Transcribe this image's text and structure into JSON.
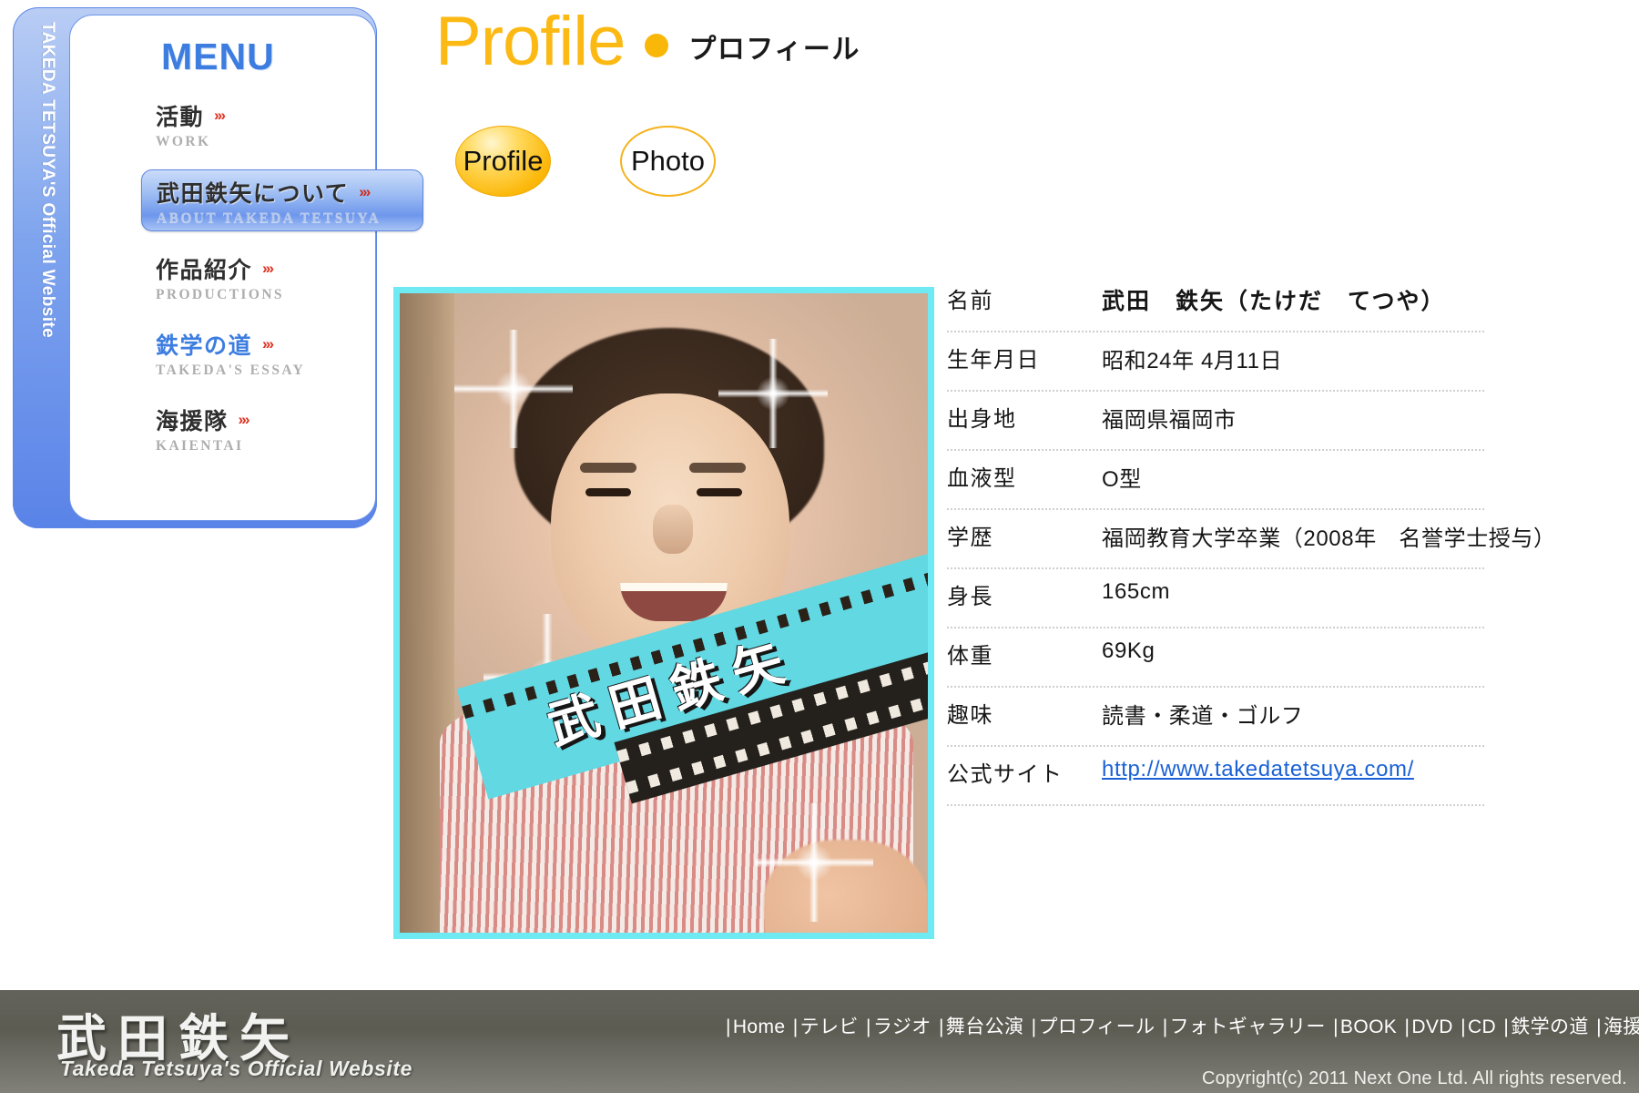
{
  "sidebar": {
    "vertical_label": "TAKEDA TETSUYA'S Official Website",
    "menu_title": "MENU",
    "items": [
      {
        "jp": "活動",
        "en": "WORK",
        "arrow": "›››",
        "active": false,
        "blue": false
      },
      {
        "jp": "武田鉄矢について",
        "en": "ABOUT TAKEDA TETSUYA",
        "arrow": "›››",
        "active": true,
        "blue": false
      },
      {
        "jp": "作品紹介",
        "en": "PRODUCTIONS",
        "arrow": "›››",
        "active": false,
        "blue": false
      },
      {
        "jp": "鉄学の道",
        "en": "TAKEDA'S ESSAY",
        "arrow": "›››",
        "active": false,
        "blue": true
      },
      {
        "jp": "海援隊",
        "en": "KAIENTAI",
        "arrow": "›››",
        "active": false,
        "blue": false
      }
    ]
  },
  "header": {
    "title_en": "Profile",
    "title_jp": "プロフィール",
    "accent_color": "#fcb913"
  },
  "tabs": [
    {
      "label": "Profile",
      "selected": true
    },
    {
      "label": "Photo",
      "selected": false
    }
  ],
  "photo": {
    "caption": "武田鉄矢",
    "border_color": "#6feaf2",
    "film_color": "#62d8e2"
  },
  "profile": {
    "rows": [
      {
        "label": "名前",
        "value": "武田　鉄矢（たけだ　てつや）",
        "link": false
      },
      {
        "label": "生年月日",
        "value": "昭和24年 4月11日",
        "link": false
      },
      {
        "label": "出身地",
        "value": "福岡県福岡市",
        "link": false
      },
      {
        "label": "血液型",
        "value": "O型",
        "link": false
      },
      {
        "label": "学歴",
        "value": "福岡教育大学卒業（2008年　名誉学士授与）",
        "link": false
      },
      {
        "label": "身長",
        "value": "165cm",
        "link": false
      },
      {
        "label": "体重",
        "value": "69Kg",
        "link": false
      },
      {
        "label": "趣味",
        "value": "読書・柔道・ゴルフ",
        "link": false
      },
      {
        "label": "公式サイト",
        "value": "http://www.takedatetsuya.com/",
        "link": true
      }
    ]
  },
  "footer": {
    "logo_jp": "武田鉄矢",
    "logo_en": "Takeda Tetsuya's Official Website",
    "nav": [
      "Home",
      "テレビ",
      "ラジオ",
      "舞台公演",
      "プロフィール",
      "フォトギャラリー",
      "BOOK",
      "DVD",
      "CD",
      "鉄学の道",
      "海援隊"
    ],
    "copyright": "Copyright(c) 2011 Next One Ltd. All rights reserved.",
    "background_color": "#5c5c53"
  }
}
